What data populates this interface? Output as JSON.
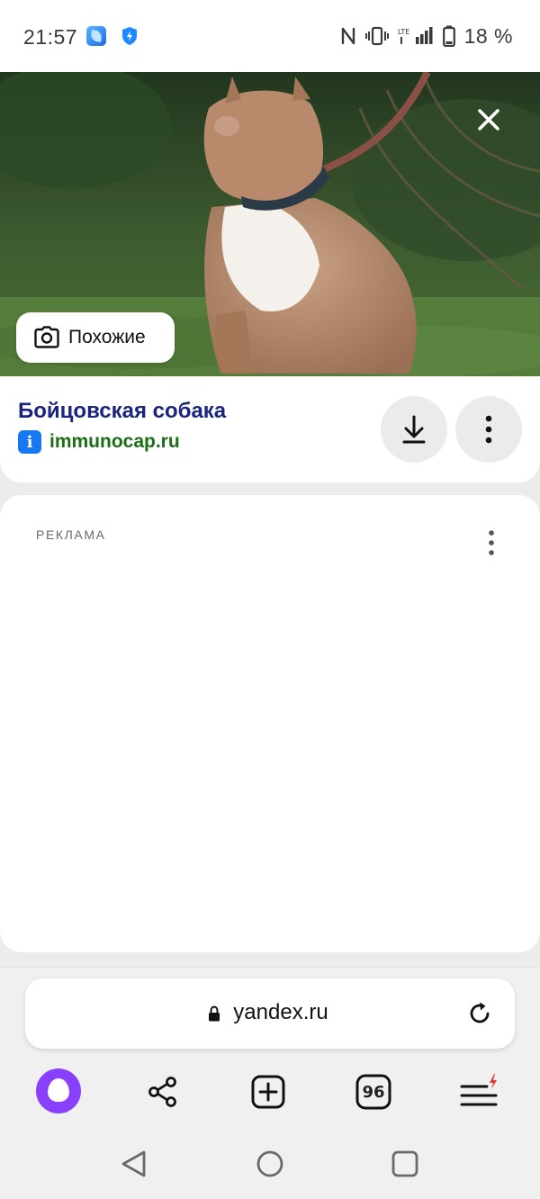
{
  "status_bar": {
    "time": "21:57",
    "battery_percent": "18 %",
    "icons": [
      "app-icon",
      "shield-icon",
      "nfc-icon",
      "vibrate-icon",
      "lte-signal-icon",
      "battery-icon"
    ]
  },
  "image_viewer": {
    "similar_label": "Похожие",
    "icons": [
      "close-icon",
      "camera-search-icon"
    ]
  },
  "result": {
    "title": "Бойцовская собака",
    "favicon_letter": "i",
    "domain": "immunocap.ru",
    "icons": [
      "download-icon",
      "more-vert-icon"
    ]
  },
  "ad": {
    "label": "РЕКЛАМА"
  },
  "browser": {
    "url": "yandex.ru",
    "tabs_count": "96",
    "icons": [
      "lock-icon",
      "reload-icon",
      "alice-icon",
      "share-icon",
      "new-tab-icon",
      "tabs-icon",
      "menu-icon"
    ]
  },
  "colors": {
    "title": "#1a237e",
    "domain": "#1b6e12",
    "alice": "#8a3ffc",
    "favicon": "#1877f2"
  }
}
